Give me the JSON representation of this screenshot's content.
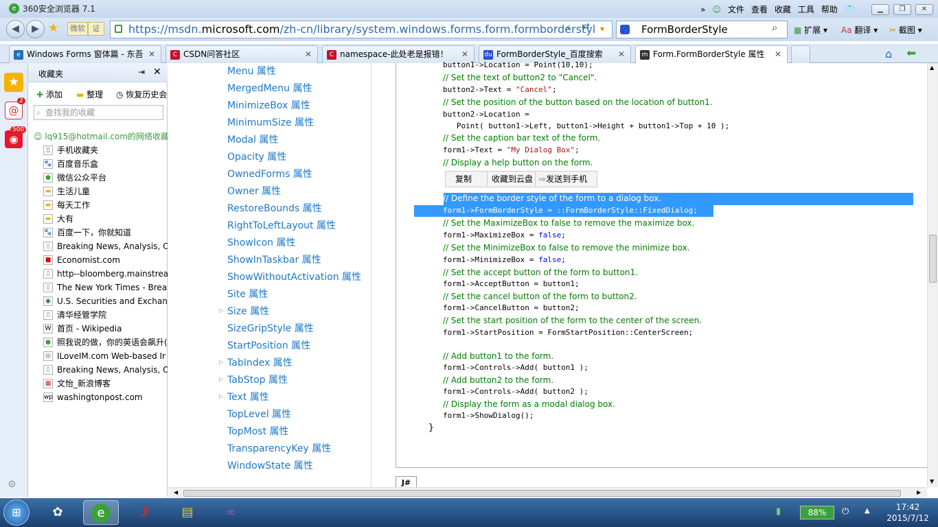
{
  "window": {
    "title": "360安全浏览器 7.1",
    "menus": [
      "文件",
      "查看",
      "收藏",
      "工具",
      "帮助"
    ]
  },
  "nav": {
    "url_prefix": "https://msdn.",
    "url_domain": "microsoft.com",
    "url_rest": "/zh-cn/library/system.windows.forms.form.formborderstyl",
    "search_value": "FormBorderStyle",
    "search_engine_label": "",
    "ext_label": "扩展",
    "translate_label": "翻译",
    "screenshot_label": "截图",
    "badge_label": "微软",
    "badge2_label": "证"
  },
  "tabs": [
    {
      "label": "Windows Forms 窗体篇 - 东吾",
      "color": "#1e6fc0",
      "glyph": "e"
    },
    {
      "label": "CSDN问答社区",
      "color": "#c8102e",
      "glyph": "C"
    },
    {
      "label": "namespace-此处老是报错！",
      "color": "#c8102e",
      "glyph": "C"
    },
    {
      "label": "FormBorderStyle_百度搜索",
      "color": "#2a4fd4",
      "glyph": "du"
    },
    {
      "label": "Form.FormBorderStyle 属性",
      "color": "#333333",
      "glyph": "m"
    }
  ],
  "favorites": {
    "header": "收藏夹",
    "add": "添加",
    "organize": "整理",
    "restore": "恢复历史会",
    "search_placeholder": "查找我的收藏",
    "account": "lq915@hotmail.com的网络收藏",
    "items": [
      "手机收藏夹",
      "百度音乐盒",
      "微信公众平台",
      "生活儿童",
      "每天工作",
      "大有",
      "百度一下，你就知道",
      "Breaking News, Analysis, O",
      "Economist.com",
      "http--bloomberg.mainstrea",
      "The New York Times - Brea",
      "U.S. Securities and Exchang",
      "清华经管学院",
      "首页 - Wikipedia",
      "照我说的做，你的英语会飙升(",
      "ILoveIM.com Web-based Ir",
      "Breaking News, Analysis, O",
      "文怡_新浪博客",
      "washingtonpost.com"
    ]
  },
  "toc": [
    "Menu 属性",
    "MergedMenu 属性",
    "MinimizeBox 属性",
    "MinimumSize 属性",
    "Modal 属性",
    "Opacity 属性",
    "OwnedForms 属性",
    "Owner 属性",
    "RestoreBounds 属性",
    "RightToLeftLayout 属性",
    "ShowIcon 属性",
    "ShowInTaskbar 属性",
    "ShowWithoutActivation 属性",
    "Site 属性",
    "Size 属性",
    "SizeGripStyle 属性",
    "StartPosition 属性",
    "TabIndex 属性",
    "TabStop 属性",
    "Text 属性",
    "TopLevel 属性",
    "TopMost 属性",
    "TransparencyKey 属性",
    "WindowState 属性"
  ],
  "code": {
    "l0": "button1->Location = Point(10,10);",
    "c1": "// Set the text of button2 to \"Cancel\".",
    "l2a": "button2->Text = ",
    "l2s": "\"Cancel\"",
    "l2b": ";",
    "c3": "// Set the position of the button based on the location of button1.",
    "l4": "button2->Location =",
    "l5": "   Point( button1->Left, button1->Height + button1->Top + 10 );",
    "c6": "// Set the caption bar text of the form.",
    "l7a": "form1->Text = ",
    "l7s": "\"My Dialog Box\"",
    "l7b": ";",
    "c8": "// Display a help button on the form.",
    "c9": "// Define the border style of the form to a dialog box.",
    "l10": "form1->FormBorderStyle = ::FormBorderStyle::FixedDialog;",
    "c11": "// Set the MaximizeBox to false to remove the maximize box.",
    "l12a": "form1->MaximizeBox = ",
    "l12k": "false",
    "l12b": ";",
    "c13": "// Set the MinimizeBox to false to remove the minimize box.",
    "l14a": "form1->MinimizeBox = ",
    "l14k": "false",
    "l14b": ";",
    "c15": "// Set the accept button of the form to button1.",
    "l16": "form1->AcceptButton = button1;",
    "c17": "// Set the cancel button of the form to button2.",
    "l18": "form1->CancelButton = button2;",
    "c19": "// Set the start position of the form to the center of the screen.",
    "l20": "form1->StartPosition = FormStartPosition::CenterScreen;",
    "c21": "// Add button1 to the form.",
    "l22": "form1->Controls->Add( button1 );",
    "c23": "// Add button2 to the form.",
    "l24": "form1->Controls->Add( button2 );",
    "c25": "// Display the form as a modal dialog box.",
    "l26": "form1->ShowDialog();",
    "l27": "}"
  },
  "context_bar": {
    "copy": "复制",
    "save_cloud": "收藏到云盘",
    "send_phone": "发送到手机"
  },
  "lang_tab": "J#",
  "taskbar": {
    "battery": "88%",
    "time": "17:42",
    "date": "2015/7/12"
  },
  "badges": {
    "mail": "2",
    "weibo": "500"
  }
}
